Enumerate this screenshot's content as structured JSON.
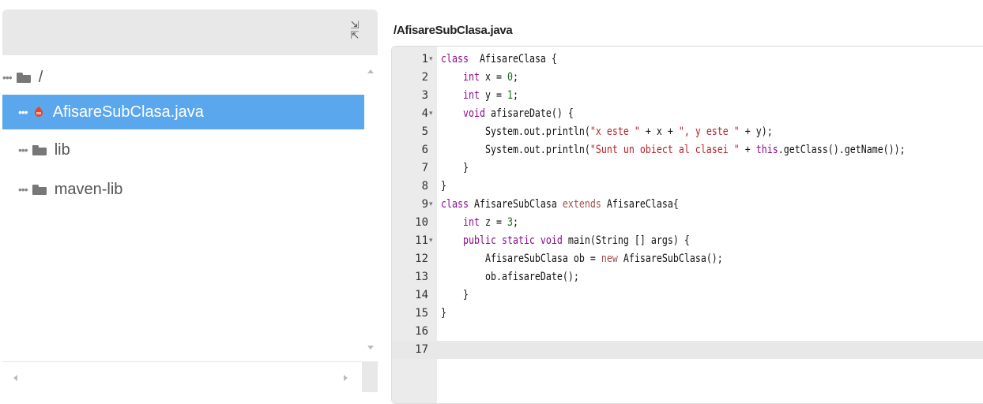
{
  "tree": {
    "items": [
      {
        "label": "/",
        "type": "folder",
        "selected": false
      },
      {
        "label": "AfisareSubClasa.java",
        "type": "java-file",
        "selected": true
      },
      {
        "label": "lib",
        "type": "folder",
        "selected": false
      },
      {
        "label": "maven-lib",
        "type": "folder",
        "selected": false
      }
    ],
    "dots": "•••",
    "collapse_icon": "collapse-arrows-icon"
  },
  "editor": {
    "file_path": "/AfisareSubClasa.java",
    "active_line": 17,
    "lines": [
      {
        "num": "1",
        "fold": "▾",
        "tokens": [
          [
            "kw",
            "class"
          ],
          [
            "",
            "  AfisareClasa {"
          ]
        ]
      },
      {
        "num": "2",
        "fold": "",
        "tokens": [
          [
            "",
            "    "
          ],
          [
            "ty",
            "int"
          ],
          [
            "",
            " x = "
          ],
          [
            "nu",
            "0"
          ],
          [
            "",
            ";"
          ]
        ]
      },
      {
        "num": "3",
        "fold": "",
        "tokens": [
          [
            "",
            "    "
          ],
          [
            "ty",
            "int"
          ],
          [
            "",
            " y = "
          ],
          [
            "nu",
            "1"
          ],
          [
            "",
            ";"
          ]
        ]
      },
      {
        "num": "4",
        "fold": "▾",
        "tokens": [
          [
            "",
            "    "
          ],
          [
            "ty",
            "void"
          ],
          [
            "",
            " afisareDate() {"
          ]
        ]
      },
      {
        "num": "5",
        "fold": "",
        "tokens": [
          [
            "",
            "        System.out.println("
          ],
          [
            "st",
            "\"x este \""
          ],
          [
            "",
            " + x + "
          ],
          [
            "st",
            "\", y este \""
          ],
          [
            "",
            " + y);"
          ]
        ]
      },
      {
        "num": "6",
        "fold": "",
        "tokens": [
          [
            "",
            "        System.out.println("
          ],
          [
            "st",
            "\"Sunt un obiect al clasei \""
          ],
          [
            "",
            " + "
          ],
          [
            "kw",
            "this"
          ],
          [
            "",
            ".getClass().getName());"
          ]
        ]
      },
      {
        "num": "7",
        "fold": "",
        "tokens": [
          [
            "",
            "    }"
          ]
        ]
      },
      {
        "num": "8",
        "fold": "",
        "tokens": [
          [
            "",
            "}"
          ]
        ]
      },
      {
        "num": "9",
        "fold": "▾",
        "tokens": [
          [
            "kw",
            "class"
          ],
          [
            "",
            " AfisareSubClasa "
          ],
          [
            "gr",
            "extends"
          ],
          [
            "",
            " AfisareClasa{"
          ]
        ]
      },
      {
        "num": "10",
        "fold": "",
        "tokens": [
          [
            "",
            "    "
          ],
          [
            "ty",
            "int"
          ],
          [
            "",
            " z = "
          ],
          [
            "nu",
            "3"
          ],
          [
            "",
            ";"
          ]
        ]
      },
      {
        "num": "11",
        "fold": "▾",
        "tokens": [
          [
            "",
            "    "
          ],
          [
            "kw",
            "public static void"
          ],
          [
            "",
            " main(String [] args) {"
          ]
        ]
      },
      {
        "num": "12",
        "fold": "",
        "tokens": [
          [
            "",
            "        AfisareSubClasa ob = "
          ],
          [
            "gr",
            "new"
          ],
          [
            "",
            " AfisareSubClasa();"
          ]
        ]
      },
      {
        "num": "13",
        "fold": "",
        "tokens": [
          [
            "",
            "        ob.afisareDate();"
          ]
        ]
      },
      {
        "num": "14",
        "fold": "",
        "tokens": [
          [
            "",
            "    }"
          ]
        ]
      },
      {
        "num": "15",
        "fold": "",
        "tokens": [
          [
            "",
            "}"
          ]
        ]
      },
      {
        "num": "16",
        "fold": "",
        "tokens": [
          [
            "",
            ""
          ]
        ]
      },
      {
        "num": "17",
        "fold": "",
        "tokens": [
          [
            "",
            ""
          ]
        ]
      }
    ]
  },
  "colors": {
    "selection": "#5aa7ee",
    "keyword": "#8b0a8b",
    "string": "#b8232b",
    "number": "#1c6a1c",
    "gutter": "#ebebeb"
  }
}
